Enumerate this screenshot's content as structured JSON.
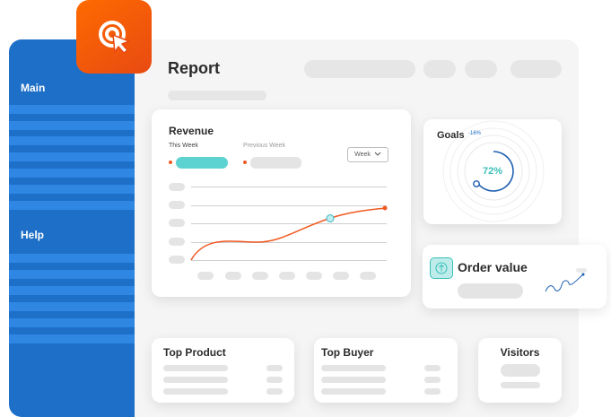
{
  "sidebar": {
    "items": [
      {
        "label": "Main"
      },
      {
        "label": "Help"
      }
    ]
  },
  "header": {
    "title": "Report"
  },
  "revenue": {
    "title": "Revenue",
    "legend_current": "This Week",
    "legend_previous": "Previous Week",
    "period_select": "Week",
    "line_color": "#f05a22",
    "current_pill_color": "#5dd3d1"
  },
  "goals": {
    "title": "Goals",
    "change": "-16%",
    "progress_text": "72%",
    "progress_value": 0.72,
    "ring_color": "#1e5fb0"
  },
  "order_value": {
    "title": "Order value",
    "icon": "arrow-up-icon",
    "accent": "#3cbfb8"
  },
  "bottom_cards": [
    {
      "title": "Top Product"
    },
    {
      "title": "Top Buyer"
    },
    {
      "title": "Visitors"
    }
  ],
  "colors": {
    "sidebar": "#1e6fc8",
    "sidebar_stripe": "#2f86e3",
    "logo": "#f05a1a"
  }
}
